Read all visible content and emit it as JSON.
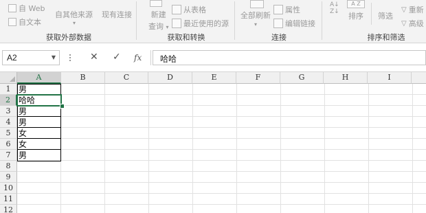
{
  "ribbon": {
    "get_external": {
      "web": "自 Web",
      "text": "自文本",
      "other_sources": "自其他来源",
      "existing_connections": "现有连接",
      "label": "获取外部数据"
    },
    "get_transform": {
      "new_query": "新建",
      "new_query2": "查询",
      "from_table": "从表格",
      "recent_sources": "最近使用的源",
      "label": "获取和转换"
    },
    "connections": {
      "refresh_all": "全部刷新",
      "properties": "属性",
      "edit_links": "编辑链接",
      "label": "连接"
    },
    "sort_filter": {
      "sort": "排序",
      "filter": "筛选",
      "reapply": "重新",
      "advanced": "高级",
      "label": "排序和筛选"
    }
  },
  "formula_bar": {
    "name_box": "A2",
    "cancel": "✕",
    "enter": "✓",
    "fx": "fx",
    "content": "哈哈"
  },
  "grid": {
    "columns": [
      "A",
      "B",
      "C",
      "D",
      "E",
      "F",
      "G",
      "H",
      "I"
    ],
    "rows": [
      "1",
      "2",
      "3",
      "4",
      "5",
      "6",
      "7",
      "8",
      "9",
      "10",
      "11",
      "12"
    ],
    "selected_cell": "A2",
    "cells": [
      "男",
      "哈哈",
      "男",
      "男",
      "女",
      "女",
      "男"
    ]
  },
  "colors": {
    "accent": "#217346",
    "ribbon_bg": "#f3f3f3",
    "header_bg": "#f0f0f0"
  }
}
